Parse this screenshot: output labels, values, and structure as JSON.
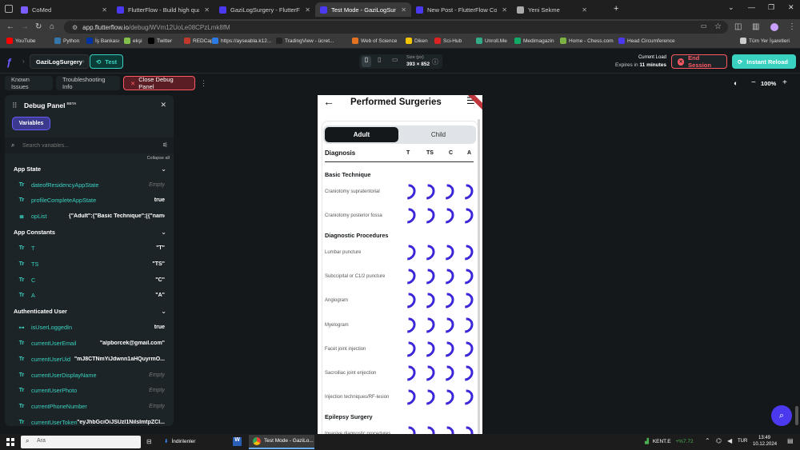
{
  "browser": {
    "tabs": [
      {
        "label": "CoMed",
        "color": "#7a5cff"
      },
      {
        "label": "FlutterFlow - Build high quality...",
        "color": "#4b39ef"
      },
      {
        "label": "GaziLogSurgery - FlutterFlow",
        "color": "#4b39ef"
      },
      {
        "label": "Test Mode - GaziLogSurgery",
        "color": "#4b39ef"
      },
      {
        "label": "New Post - FlutterFlow Commu...",
        "color": "#4b39ef"
      },
      {
        "label": "Yeni Sekme",
        "color": "#aaaaaa"
      }
    ],
    "url_host": "app.flutterflow.io",
    "url_path": "/debug/WVm12UoLe08CPzLmk8fM",
    "bookmarks": [
      "YouTube",
      "Python",
      "İş Bankası",
      "ekşi",
      "Twitter",
      "REDCap",
      "https://ayseabla.k12...",
      "TradingView - ücret...",
      "Web of Science",
      "Diken",
      "Sci-Hub",
      "Unroll.Me",
      "Medimagazin",
      "Home - Chess.com",
      "Head Circumference",
      "Tüm Yer İşaretleri"
    ]
  },
  "ff": {
    "project": "GaziLogSurgery",
    "mode": "Test",
    "size_label": "Size (px)",
    "size_value": "393 × 852",
    "current_load": "Current Load",
    "expires_prefix": "Expires in",
    "expires_value": "11 minutes",
    "end_session": "End Session",
    "instant_reload": "Instant Reload",
    "known_issues": "Known Issues",
    "troubleshooting": "Troubleshooting Info",
    "close_debug": "Close Debug Panel",
    "zoom": "100%"
  },
  "panel": {
    "title": "Debug Panel",
    "beta": "BETA",
    "tab": "Variables",
    "search_placeholder": "Search variables...",
    "collapse_all": "Collapse all",
    "sections": [
      {
        "title": "App State",
        "items": [
          {
            "icon": "Tr",
            "name": "dateofResidencyAppState",
            "value": "Empty",
            "empty": true
          },
          {
            "icon": "Tr",
            "name": "profileCompleteAppState",
            "value": "true",
            "empty": false
          },
          {
            "icon": "≣",
            "name": "opList",
            "value": "{\"Adult\":{\"Basic Technique\":[{\"name\":\"Crani...",
            "empty": false
          }
        ]
      },
      {
        "title": "App Constants",
        "items": [
          {
            "icon": "Tr",
            "name": "T",
            "value": "\"T\"",
            "empty": false
          },
          {
            "icon": "Tr",
            "name": "TS",
            "value": "\"TS\"",
            "empty": false
          },
          {
            "icon": "Tr",
            "name": "C",
            "value": "\"C\"",
            "empty": false
          },
          {
            "icon": "Tr",
            "name": "A",
            "value": "\"A\"",
            "empty": false
          }
        ]
      },
      {
        "title": "Authenticated User",
        "items": [
          {
            "icon": "⊶",
            "name": "isUserLoggedIn",
            "value": "true",
            "empty": false
          },
          {
            "icon": "Tr",
            "name": "currentUserEmail",
            "value": "\"alpborcek@gmail.com\"",
            "empty": false
          },
          {
            "icon": "Tr",
            "name": "currentUserUid",
            "value": "\"mJ8CTNmYiJdwnn1aHQuyrmO...",
            "empty": false
          },
          {
            "icon": "Tr",
            "name": "currentUserDisplayName",
            "value": "Empty",
            "empty": true
          },
          {
            "icon": "Tr",
            "name": "currentUserPhoto",
            "value": "Empty",
            "empty": true
          },
          {
            "icon": "Tr",
            "name": "currentPhoneNumber",
            "value": "Empty",
            "empty": true
          },
          {
            "icon": "Tr",
            "name": "currentUserToken",
            "value": "\"eyJhbGciOiJSUzI1NiIsImtpZCI...",
            "empty": false
          }
        ]
      }
    ]
  },
  "app": {
    "title": "Performed Surgeries",
    "tab_adult": "Adult",
    "tab_child": "Child",
    "col_diagnosis": "Diagnosis",
    "cols": [
      "T",
      "TS",
      "C",
      "A"
    ],
    "groups": [
      {
        "title": "Basic Technique",
        "rows": [
          "Craniotomy supratentorial",
          "Craniotomy posterior fossa"
        ]
      },
      {
        "title": "Diagnostic Procedures",
        "rows": [
          "Lumbar puncture",
          "Subccipital or C1/2 puncture",
          "Angiogram",
          "Myelogram",
          "Facet joint injection",
          "Sacroiliac joint enjection",
          "Injection techniques/RF-lesion"
        ]
      },
      {
        "title": "Epilepsy Surgery",
        "rows": [
          "Invasive diagnostic procedures (deep electrodes,grids,plates)"
        ]
      }
    ]
  },
  "taskbar": {
    "search": "Ara",
    "downloads": "İndirilenler",
    "chrome": "Test Mode - GaziLo...",
    "ticker": "KENT.E",
    "ticker_change": "+%7.72",
    "lang": "TUR",
    "time": "13:49",
    "date": "10.12.2024"
  }
}
